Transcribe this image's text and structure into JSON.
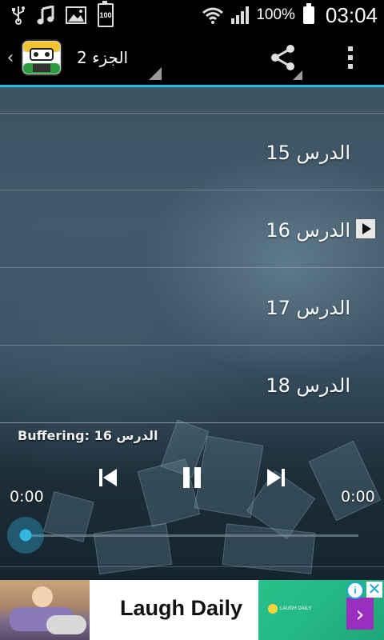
{
  "status_bar": {
    "icons": [
      "usb-icon",
      "music-note-icon",
      "image-icon",
      "battery-100-icon",
      "wifi-icon",
      "signal-icon"
    ],
    "small_battery_text": "100",
    "battery_percent": "100%",
    "time": "03:04"
  },
  "action_bar": {
    "title": "الجزء 2",
    "share_icon": "share-icon",
    "menu_icon": "overflow-menu-icon"
  },
  "lessons": [
    {
      "label": "الدرس 15",
      "playing": false
    },
    {
      "label": "الدرس 16",
      "playing": true
    },
    {
      "label": "الدرس 17",
      "playing": false
    },
    {
      "label": "الدرس 18",
      "playing": false
    }
  ],
  "player": {
    "status": "Buffering: الدرس 16",
    "elapsed": "0:00",
    "duration": "0:00",
    "progress": 0
  },
  "ad": {
    "headline": "Laugh Daily",
    "brand_text": "LAUGH DAILY",
    "info_symbol": "i",
    "close_symbol": "✕",
    "cta_symbol": "›",
    "colors": {
      "logo_bg": "#29c08a",
      "cta_bg": "#9b2dbf",
      "adchoices": "#1aa7e0"
    }
  },
  "colors": {
    "accent": "#33b5e5",
    "bar_bg": "#000000"
  }
}
